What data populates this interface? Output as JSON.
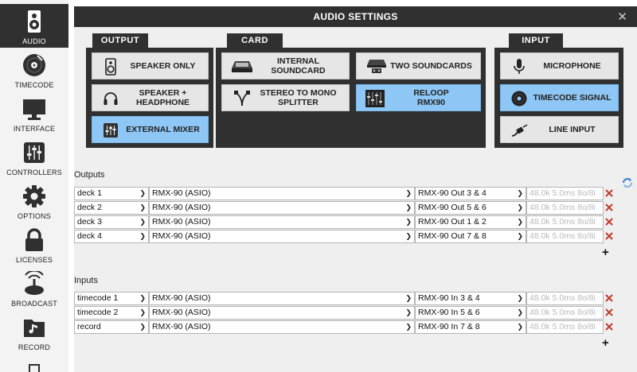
{
  "window": {
    "title": "AUDIO SETTINGS",
    "close_glyph": "✕"
  },
  "sidebar": {
    "items": [
      {
        "label": "AUDIO",
        "icon": "speaker-icon",
        "active": true
      },
      {
        "label": "TIMECODE",
        "icon": "vinyl-icon",
        "active": false
      },
      {
        "label": "INTERFACE",
        "icon": "monitor-icon",
        "active": false
      },
      {
        "label": "CONTROLLERS",
        "icon": "sliders-icon",
        "active": false
      },
      {
        "label": "OPTIONS",
        "icon": "gear-icon",
        "active": false
      },
      {
        "label": "LICENSES",
        "icon": "lock-icon",
        "active": false
      },
      {
        "label": "BROADCAST",
        "icon": "broadcast-icon",
        "active": false
      },
      {
        "label": "RECORD",
        "icon": "record-icon",
        "active": false
      }
    ]
  },
  "output": {
    "label": "OUTPUT",
    "options": [
      {
        "label": "SPEAKER ONLY",
        "icon": "speaker-icon",
        "selected": false
      },
      {
        "label": "SPEAKER +\nHEADPHONE",
        "icon": "headphone-icon",
        "selected": false
      },
      {
        "label": "EXTERNAL MIXER",
        "icon": "mixer-icon",
        "selected": true
      }
    ]
  },
  "card": {
    "label": "CARD",
    "options": [
      {
        "label": "INTERNAL\nSOUNDCARD",
        "icon": "internal-soundcard-icon",
        "selected": false
      },
      {
        "label": "TWO SOUNDCARDS",
        "icon": "two-soundcards-icon",
        "selected": false
      },
      {
        "label": "STEREO TO MONO\nSPLITTER",
        "icon": "splitter-cable-icon",
        "selected": false
      },
      {
        "label": "RELOOP\nRMX90",
        "icon": "reloop-rmx90-icon",
        "selected": true
      }
    ]
  },
  "input": {
    "label": "INPUT",
    "options": [
      {
        "label": "MICROPHONE",
        "icon": "microphone-icon",
        "selected": false
      },
      {
        "label": "TIMECODE SIGNAL",
        "icon": "timecode-disc-icon",
        "selected": true
      },
      {
        "label": "LINE INPUT",
        "icon": "line-cable-icon",
        "selected": false
      }
    ]
  },
  "outputs": {
    "title": "Outputs",
    "rows": [
      {
        "channel": "deck 1",
        "device": "RMX-90 (ASIO)",
        "port": "RMX-90 Out 3 & 4",
        "format": "48.0k 5.0ms 8o/8i"
      },
      {
        "channel": "deck 2",
        "device": "RMX-90 (ASIO)",
        "port": "RMX-90 Out 5 & 6",
        "format": "48.0k 5.0ms 8o/8i"
      },
      {
        "channel": "deck 3",
        "device": "RMX-90 (ASIO)",
        "port": "RMX-90 Out 1 & 2",
        "format": "48.0k 5.0ms 8o/8i"
      },
      {
        "channel": "deck 4",
        "device": "RMX-90 (ASIO)",
        "port": "RMX-90 Out 7 & 8",
        "format": "48.0k 5.0ms 8o/8i"
      }
    ],
    "add_glyph": "+"
  },
  "inputs": {
    "title": "Inputs",
    "rows": [
      {
        "channel": "timecode 1",
        "device": "RMX-90 (ASIO)",
        "port": "RMX-90 In 3 & 4",
        "format": "48.0k 5.0ms 8o/8i"
      },
      {
        "channel": "timecode 2",
        "device": "RMX-90 (ASIO)",
        "port": "RMX-90 In 5 & 6",
        "format": "48.0k 5.0ms 8o/8i"
      },
      {
        "channel": "record",
        "device": "RMX-90 (ASIO)",
        "port": "RMX-90 In 7 & 8",
        "format": "48.0k 5.0ms 8o/8i"
      }
    ],
    "add_glyph": "+"
  },
  "colors": {
    "dark": "#303030",
    "selected": "#8ec7f5",
    "delete": "#c0392b",
    "refresh": "#3a7fc9"
  }
}
